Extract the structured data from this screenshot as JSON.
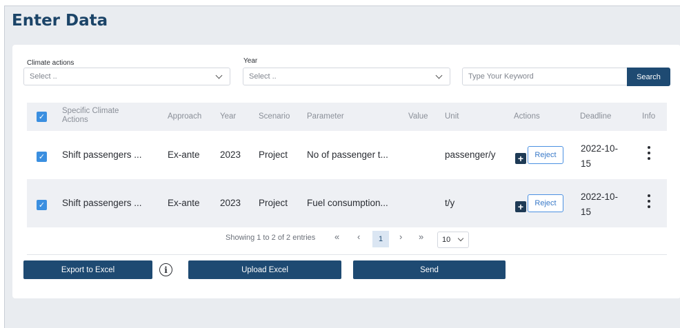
{
  "page": {
    "title": "Enter Data"
  },
  "filters": {
    "climate_actions_label": "Climate actions",
    "climate_actions_placeholder": "Select ..",
    "year_label": "Year",
    "year_placeholder": "Select ..",
    "search_placeholder": "Type Your Keyword",
    "search_button": "Search"
  },
  "table": {
    "headers": {
      "specific_climate_actions_line1": "Specific Climate",
      "specific_climate_actions_line2": "Actions",
      "approach": "Approach",
      "year": "Year",
      "scenario": "Scenario",
      "parameter": "Parameter",
      "value": "Value",
      "unit": "Unit",
      "actions": "Actions",
      "deadline": "Deadline",
      "info": "Info"
    },
    "rows": [
      {
        "checked": true,
        "action": "Shift passengers ...",
        "approach": "Ex-ante",
        "year": "2023",
        "scenario": "Project",
        "parameter": "No of passenger t...",
        "value": "",
        "unit": "passenger/y",
        "reject_label": "Reject",
        "deadline_line1": "2022-10-",
        "deadline_line2": "15"
      },
      {
        "checked": true,
        "action": "Shift passengers ...",
        "approach": "Ex-ante",
        "year": "2023",
        "scenario": "Project",
        "parameter": "Fuel consumption...",
        "value": "",
        "unit": "t/y",
        "reject_label": "Reject",
        "deadline_line1": "2022-10-",
        "deadline_line2": "15"
      }
    ]
  },
  "pagination": {
    "summary": "Showing 1 to 2 of 2 entries",
    "first": "«",
    "prev": "‹",
    "current_page": "1",
    "next": "›",
    "last": "»",
    "page_size": "10"
  },
  "buttons": {
    "export_excel": "Export to Excel",
    "upload_excel": "Upload Excel",
    "send": "Send"
  },
  "icons": {
    "info": "i",
    "checkmark": "✓",
    "plus": "+"
  },
  "colors": {
    "primary": "#1e4a72",
    "checkbox": "#3b8fe0",
    "reject_border": "#4a90e2"
  }
}
